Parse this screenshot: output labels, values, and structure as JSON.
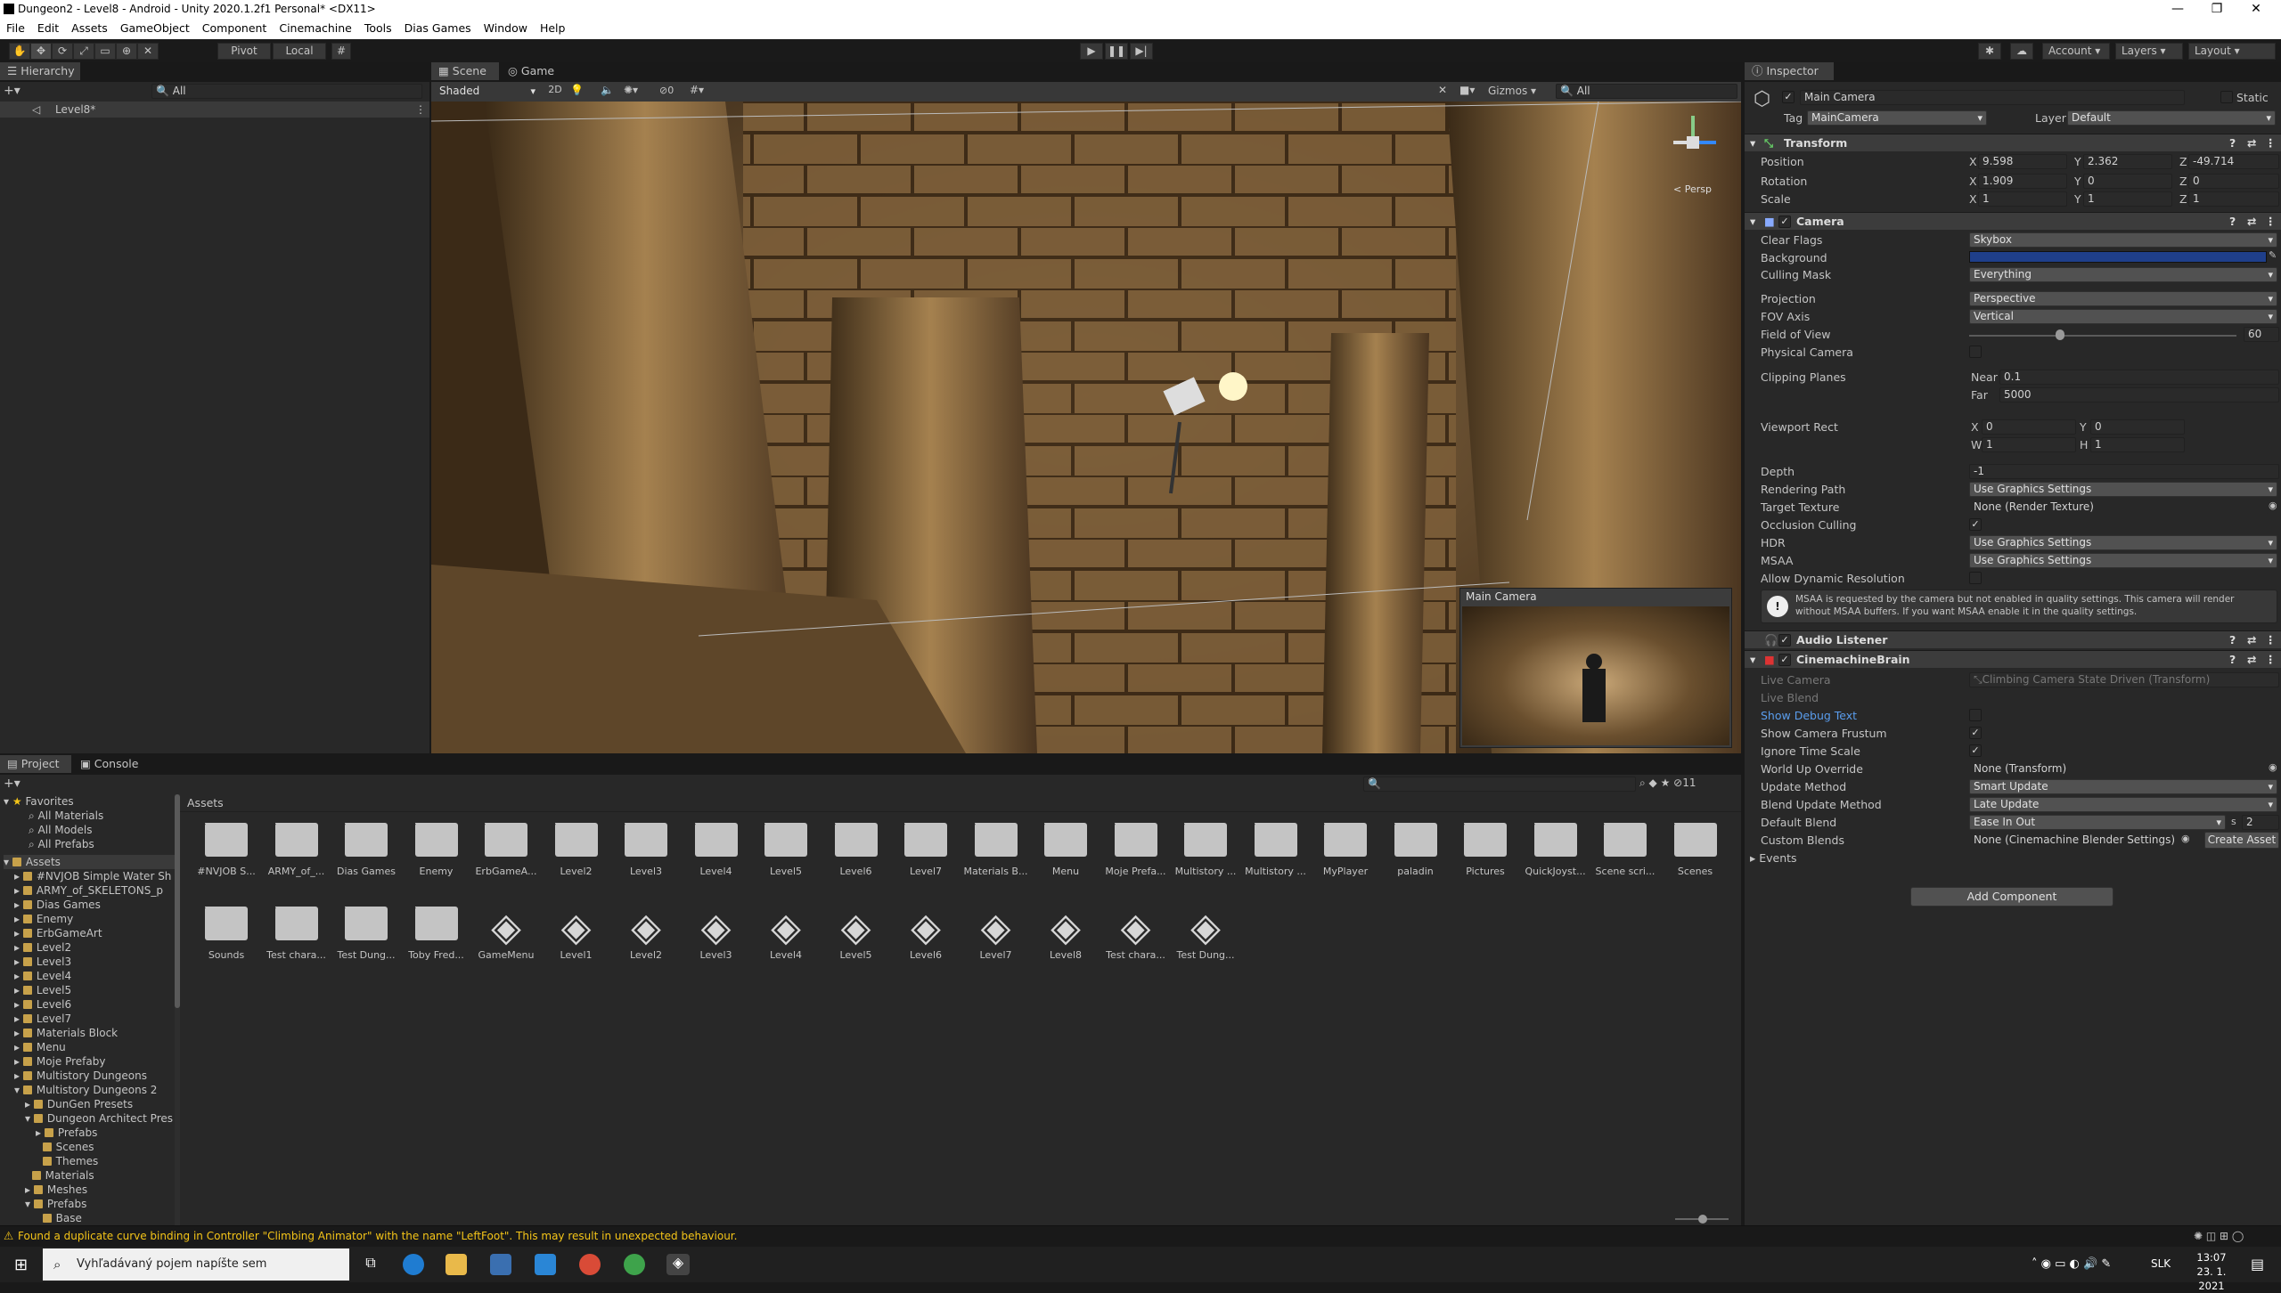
{
  "window": {
    "title": "Dungeon2 - Level8 - Android - Unity 2020.1.2f1 Personal* <DX11>"
  },
  "menu": [
    "File",
    "Edit",
    "Assets",
    "GameObject",
    "Component",
    "Cinemachine",
    "Tools",
    "Dias Games",
    "Window",
    "Help"
  ],
  "toolbar": {
    "pivot": "Pivot",
    "local": "Local",
    "account": "Account",
    "layers": "Layers",
    "layout": "Layout"
  },
  "hierarchy": {
    "tab": "Hierarchy",
    "search": "All",
    "root": "Level8*"
  },
  "scene": {
    "tab_scene": "Scene",
    "tab_game": "Game",
    "shading": "Shaded",
    "mode2d": "2D",
    "gizmos": "Gizmos",
    "search": "All",
    "hidden_count": "0",
    "persp": "< Persp",
    "preview_title": "Main Camera"
  },
  "inspector": {
    "tab": "Inspector",
    "object_name": "Main Camera",
    "static": "Static",
    "tag_label": "Tag",
    "tag": "MainCamera",
    "layer_label": "Layer",
    "layer": "Default",
    "transform": {
      "title": "Transform",
      "position_label": "Position",
      "rotation_label": "Rotation",
      "scale_label": "Scale",
      "px": "9.598",
      "py": "2.362",
      "pz": "-49.714",
      "rx": "1.909",
      "ry": "0",
      "rz": "0",
      "sx": "1",
      "sy": "1",
      "sz": "1"
    },
    "camera": {
      "title": "Camera",
      "clear_flags_label": "Clear Flags",
      "clear_flags": "Skybox",
      "background_label": "Background",
      "background_color": "#1f3f8a",
      "culling_mask_label": "Culling Mask",
      "culling_mask": "Everything",
      "projection_label": "Projection",
      "projection": "Perspective",
      "fov_axis_label": "FOV Axis",
      "fov_axis": "Vertical",
      "fov_label": "Field of View",
      "fov": "60",
      "fov_fraction": 0.34,
      "physical_label": "Physical Camera",
      "clipping_label": "Clipping Planes",
      "near_label": "Near",
      "near": "0.1",
      "far_label": "Far",
      "far": "5000",
      "viewport_label": "Viewport Rect",
      "vx": "0",
      "vy": "0",
      "vw": "1",
      "vh": "1",
      "depth_label": "Depth",
      "depth": "-1",
      "rendering_label": "Rendering Path",
      "rendering": "Use Graphics Settings",
      "target_label": "Target Texture",
      "target": "None (Render Texture)",
      "occlusion_label": "Occlusion Culling",
      "hdr_label": "HDR",
      "hdr": "Use Graphics Settings",
      "msaa_label": "MSAA",
      "msaa": "Use Graphics Settings",
      "dynres_label": "Allow Dynamic Resolution",
      "warning": "MSAA is requested by the camera but not enabled in quality settings. This camera will render without MSAA buffers. If you want MSAA enable it in the quality settings."
    },
    "audio": {
      "title": "Audio Listener"
    },
    "brain": {
      "title": "CinemachineBrain",
      "live_camera_label": "Live Camera",
      "live_camera": "Climbing Camera State Driven (Transform)",
      "live_blend_label": "Live Blend",
      "debug_label": "Show Debug Text",
      "frustum_label": "Show Camera Frustum",
      "ignore_label": "Ignore Time Scale",
      "worldup_label": "World Up Override",
      "worldup": "None (Transform)",
      "update_label": "Update Method",
      "update": "Smart Update",
      "blend_update_label": "Blend Update Method",
      "blend_update": "Late Update",
      "default_blend_label": "Default Blend",
      "default_blend": "Ease In Out",
      "blend_s": "s",
      "blend_time": "2",
      "custom_label": "Custom Blends",
      "custom": "None (Cinemachine Blender Settings)",
      "create_asset": "Create Asset",
      "events": "Events"
    },
    "add_component": "Add Component"
  },
  "project": {
    "tab_project": "Project",
    "tab_console": "Console",
    "favorites": "Favorites",
    "fav_items": [
      "All Materials",
      "All Models",
      "All Prefabs"
    ],
    "assets_root": "Assets",
    "breadcrumb": "Assets",
    "hidden_count": "11",
    "tree": [
      "#NVJOB Simple Water Sh",
      "ARMY_of_SKELETONS_p",
      "Dias Games",
      "Enemy",
      "ErbGameArt",
      "Level2",
      "Level3",
      "Level4",
      "Level5",
      "Level6",
      "Level7",
      "Materials Block",
      "Menu",
      "Moje Prefaby",
      "Multistory Dungeons",
      "Multistory Dungeons 2"
    ],
    "tree2": [
      "DunGen Presets",
      "Dungeon Architect Pres"
    ],
    "tree3": [
      "Prefabs",
      "Scenes",
      "Themes"
    ],
    "tree4": [
      "Materials",
      "Meshes",
      "Prefabs"
    ],
    "tree5": [
      "Base"
    ],
    "row1": [
      "#NVJOB S...",
      "ARMY_of_...",
      "Dias Games",
      "Enemy",
      "ErbGameA...",
      "Level2",
      "Level3",
      "Level4",
      "Level5",
      "Level6",
      "Level7",
      "Materials B...",
      "Menu",
      "Moje Prefa...",
      "Multistory ...",
      "Multistory ...",
      "MyPlayer",
      "paladin",
      "Pictures",
      "QuickJoyst...",
      "Scene scri...",
      "Scenes"
    ],
    "row2_folders": [
      "Sounds",
      "Test chara...",
      "Test Dung...",
      "Toby Fred..."
    ],
    "row2_scenes": [
      "GameMenu",
      "Level1",
      "Level2",
      "Level3",
      "Level4",
      "Level5",
      "Level6",
      "Level7",
      "Level8",
      "Test chara...",
      "Test Dung..."
    ]
  },
  "status": {
    "message": "Found a duplicate curve binding in Controller \"Climbing Animator\" with the name \"LeftFoot\". This may result in unexpected behaviour."
  },
  "taskbar": {
    "search": "Vyhľadávaný pojem napíšte sem",
    "lang": "SLK",
    "time": "13:07",
    "date": "23. 1. 2021"
  }
}
